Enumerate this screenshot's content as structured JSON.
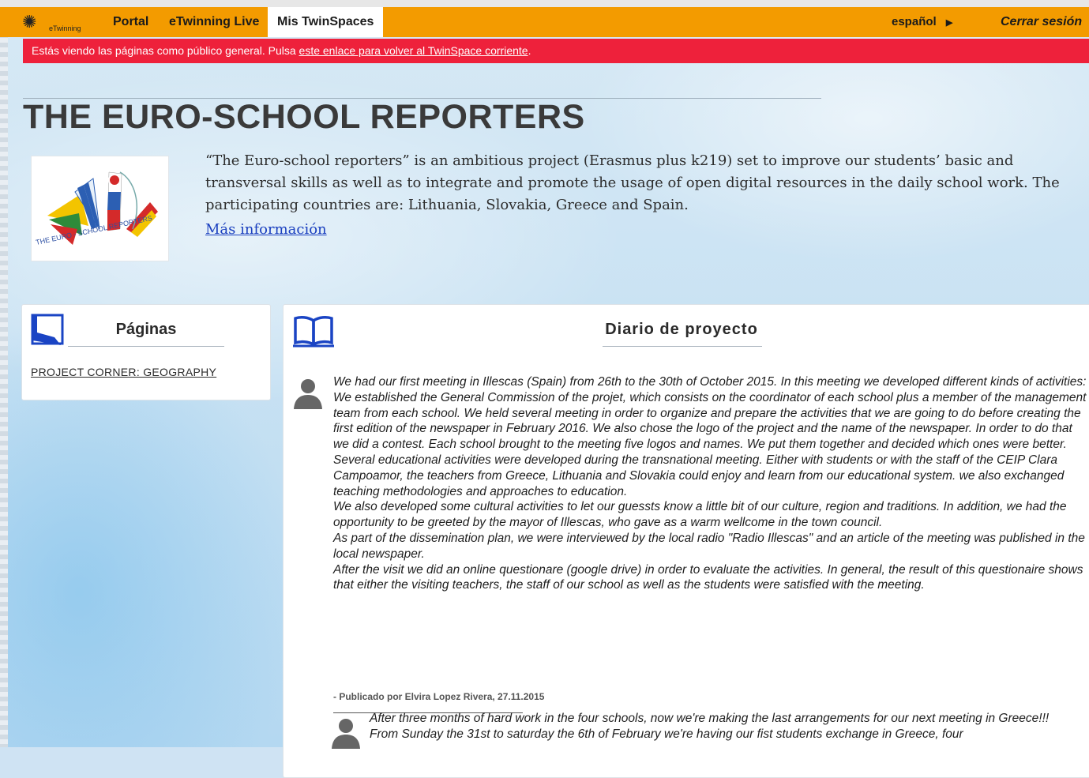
{
  "topbar": {
    "logo_text": "eTwinning",
    "nav": [
      "Portal",
      "eTwinning Live",
      "Mis TwinSpaces"
    ],
    "language": "español",
    "language_arrow": "▶",
    "logout": "Cerrar sesión"
  },
  "notice": {
    "text": "Estás viendo las páginas como público general. Pulsa ",
    "link": "este enlace para volver al TwinSpace corriente",
    "tail": "."
  },
  "project": {
    "title": "THE EURO-SCHOOL REPORTERS",
    "logo_text": "THE EURO - SCHOOL REPORTERS",
    "description": "“The Euro-school reporters” is an ambitious project (Erasmus plus k219) set to improve our students’ basic and transversal skills as well as to integrate and promote the usage of open digital resources in the daily school work. The participating countries are: Lithuania, Slovakia, Greece and Spain.",
    "more_link": "Más información"
  },
  "pages_panel": {
    "heading": "Páginas",
    "items": [
      "PROJECT CORNER: GEOGRAPHY"
    ]
  },
  "diary_panel": {
    "heading": "Diario de proyecto",
    "post1": {
      "paragraphs": [
        "We had our first meeting in Illescas (Spain) from 26th to the 30th of October 2015. In this meeting we developed different kinds of activities:",
        "We established the General Commission of the projet, which consists on the coordinator of each school plus a member of the management team from each school. We held several meeting in order to organize and prepare the activities that we are going to do before creating the first edition of the newspaper in February 2016. We also chose the logo of the project and the name of the newspaper. In order to do that we did a contest. Each school brought to the meeting five logos and names. We put them together and decided which ones were better.",
        "Several educational activities were developed during the transnational meeting. Either with students or with the staff of the CEIP Clara Campoamor, the teachers from Greece, Lithuania and Slovakia could enjoy and learn from our educational system. we also exchanged teaching methodologies and approaches to education.",
        "We also developed some cultural activities to let our guessts know a little bit of our culture, region and traditions. In addition, we had the opportunity to be greeted by the mayor of Illescas, who gave as a warm wellcome in the town council.",
        "As part of the dissemination plan, we were interviewed by the local radio \"Radio Illescas\" and an article of the meeting was published in the local newspaper.",
        "After the visit we did an online questionare (google drive) in order to evaluate the activities. In general, the result of this questionaire shows that either the visiting teachers, the staff of our school as well as the students were satisfied with the meeting."
      ],
      "byline": "- Publicado por Elvira Lopez Rivera, 27.11.2015"
    },
    "post2": {
      "paragraphs": [
        "After three months of hard work in the four schools, now we're making the last arrangements for our next meeting in Greece!!!",
        "From Sunday the 31st to saturday the 6th of February we're having our fist students exchange in Greece, four"
      ]
    }
  }
}
